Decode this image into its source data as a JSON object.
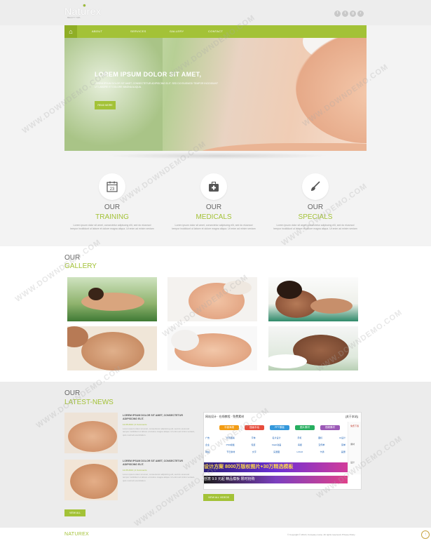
{
  "header": {
    "logo": "Naturex",
    "logo_sub": "BEAUTY SPA",
    "social_icons": [
      "facebook-icon",
      "twitter-icon",
      "google-plus-icon",
      "rss-icon"
    ]
  },
  "nav": {
    "home_icon": "home-icon",
    "items": [
      "ABOUT",
      "SERVICES",
      "GALLERY",
      "CONTACT"
    ]
  },
  "hero": {
    "title": "LOREM IPSUM DOLOR SIT AMET,",
    "text": "LOREM IPSUM DOLOR SIT AMET, CONSECTETUR ADIPISCING ELIT. SED DO EIUSMOD TEMPOR INCIDIDUNT UT LABORE ET DOLORE MAGNA ALIQUA.",
    "button": "READ MORE"
  },
  "features": [
    {
      "icon": "calendar-icon",
      "icon_text": "23",
      "our": "OUR",
      "name": "TRAINING",
      "text": "Lorem ipsum dolor sit amet, consectetur adipiscing elit, sed do eiusmod tempor incididunt ut labore et dolore magna aliqua. Ut enim ad minim veniam"
    },
    {
      "icon": "medical-kit-icon",
      "icon_text": "✚",
      "our": "OUR",
      "name": "MEDICALS",
      "text": "Lorem ipsum dolor sit amet, consectetur adipiscing elit, sed do eiusmod tempor incididunt ut labore et dolore magna aliqua. Ut enim ad minim veniam"
    },
    {
      "icon": "brush-icon",
      "icon_text": "✎",
      "our": "OUR",
      "name": "SPECIALS",
      "text": "Lorem ipsum dolor sit amet, consectetur adipiscing elit, sed do eiusmod tempor incididunt ut labore et dolore magna aliqua. Ut enim ad minim veniam"
    }
  ],
  "gallery": {
    "our": "OUR",
    "title": "GALLERY"
  },
  "news": {
    "our": "OUR",
    "title": "LATEST-NEWS",
    "items": [
      {
        "headline": "LOREM IPSUM DOLOR SIT AMET, CONSECTETUR ADIPISCING ELIT.",
        "meta": "12.05.2013 | 2 Comments",
        "body": "Lorem ipsum dolor sit amet, consectetur adipiscing elit, sed do eiusmod tempor incididunt ut labore et dolore magna aliqua. Ut enim ad minim veniam, quis nostrud exercitation."
      },
      {
        "headline": "LOREM IPSUM DOLOR SIT AMET, CONSECTETUR ADIPISCING ELIT.",
        "meta": "12.05.2013 | 2 Comments",
        "body": "Lorem ipsum dolor sit amet, consectetur adipiscing elit, sed do eiusmod tempor incididunt ut labore et dolore magna aliqua. Ut enim ad minim veniam, quis nostrud exercitation."
      }
    ],
    "view_all_left": "VIEW ALL",
    "view_all_right": "VIEW ALL VIDEOS"
  },
  "ad": {
    "head_left": "网站设计 · 在线教程 · 免费素材",
    "head_right": "[关于本站]",
    "pills": [
      "平面海报",
      "插画手绘",
      "PPT模板",
      "图片素材",
      "视频素材"
    ],
    "pill_colors": [
      "#f39c12",
      "#e74c3c",
      "#3498db",
      "#27ae60",
      "#9b59b6"
    ],
    "grid_rows": [
      [
        "广告",
        "背景图案",
        "字体",
        "名片设计",
        "手机",
        "图标",
        "UI设计"
      ],
      [
        "企业",
        "PSD模板",
        "包装",
        "Flash动画",
        "海报",
        "宣传单",
        "菜单"
      ],
      [
        "网站",
        "节日素材",
        "文字",
        "矢量图",
        "LOGO",
        "卡通",
        "画册"
      ]
    ],
    "banner1": "设计方案  8000万版权图片+30万精选模板",
    "banner2": "创意 9.9 元起  精品模板 限时抢购",
    "side_labels": [
      "免费下载",
      "素材",
      "设计"
    ]
  },
  "footer": {
    "logo": "NATUREX",
    "copyright": "© Copyright © 2013 | Company name. All rights reserved | Privacy Policy",
    "up_icon": "arrow-up-icon"
  },
  "watermark": "WWW.DOWNDEMO.COM"
}
